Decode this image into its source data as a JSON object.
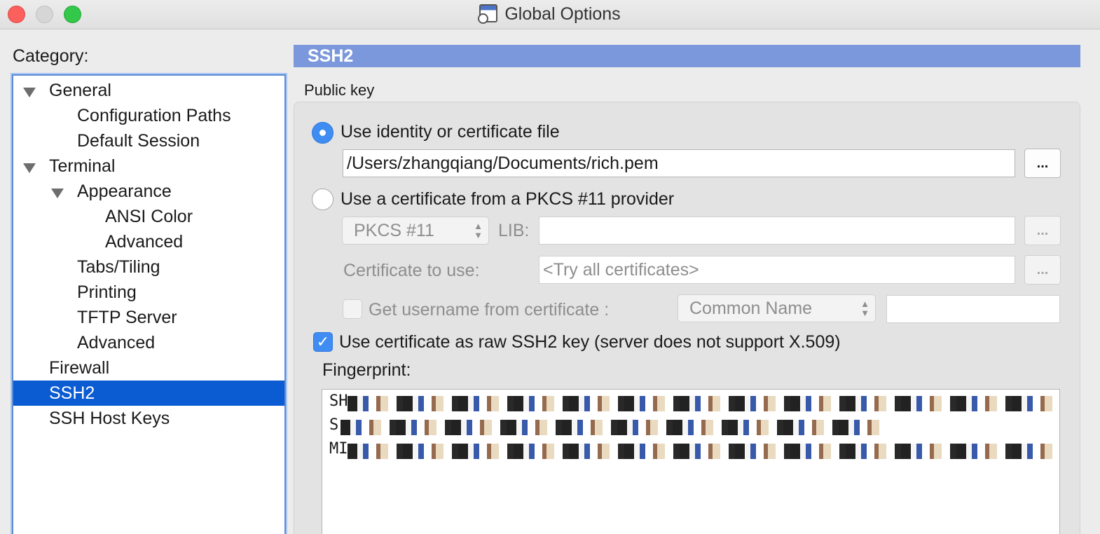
{
  "window": {
    "title": "Global Options",
    "icon": "securecrt-app-icon"
  },
  "category": {
    "label": "Category:",
    "items": [
      {
        "label": "General",
        "level": 0,
        "expanded": true
      },
      {
        "label": "Configuration Paths",
        "level": 1
      },
      {
        "label": "Default Session",
        "level": 1
      },
      {
        "label": "Terminal",
        "level": 0,
        "expanded": true
      },
      {
        "label": "Appearance",
        "level": 1,
        "expanded": true
      },
      {
        "label": "ANSI Color",
        "level": 2
      },
      {
        "label": "Advanced",
        "level": 2
      },
      {
        "label": "Tabs/Tiling",
        "level": 1
      },
      {
        "label": "Printing",
        "level": 1
      },
      {
        "label": "TFTP Server",
        "level": 1
      },
      {
        "label": "Advanced",
        "level": 1
      },
      {
        "label": "Firewall",
        "level": 0
      },
      {
        "label": "SSH2",
        "level": 0,
        "selected": true
      },
      {
        "label": "SSH Host Keys",
        "level": 0
      }
    ]
  },
  "panel": {
    "header": "SSH2",
    "group_label": "Public key",
    "identity": {
      "label": "Use identity or certificate file",
      "selected": true,
      "path": "/Users/zhangqiang/Documents/rich.pem",
      "browse": "..."
    },
    "pkcs": {
      "label": "Use a certificate from a PKCS #11 provider",
      "selected": false,
      "provider": "PKCS #11",
      "lib_label": "LIB:",
      "lib_value": "",
      "browse": "...",
      "cert_label": "Certificate to use:",
      "cert_value": "<Try all certificates>",
      "cert_browse": "...",
      "username_label": "Get username from certificate :",
      "username_checked": false,
      "username_source": "Common Name",
      "username_value": ""
    },
    "raw_key": {
      "label": "Use certificate as raw SSH2 key (server does not support X.509)",
      "checked": true
    },
    "fingerprint": {
      "label": "Fingerprint:",
      "lines": [
        "SH",
        "S",
        "MI"
      ]
    }
  },
  "colors": {
    "selection": "#0b5bd2",
    "header": "#7b98dc",
    "accent": "#3f8cf2"
  }
}
